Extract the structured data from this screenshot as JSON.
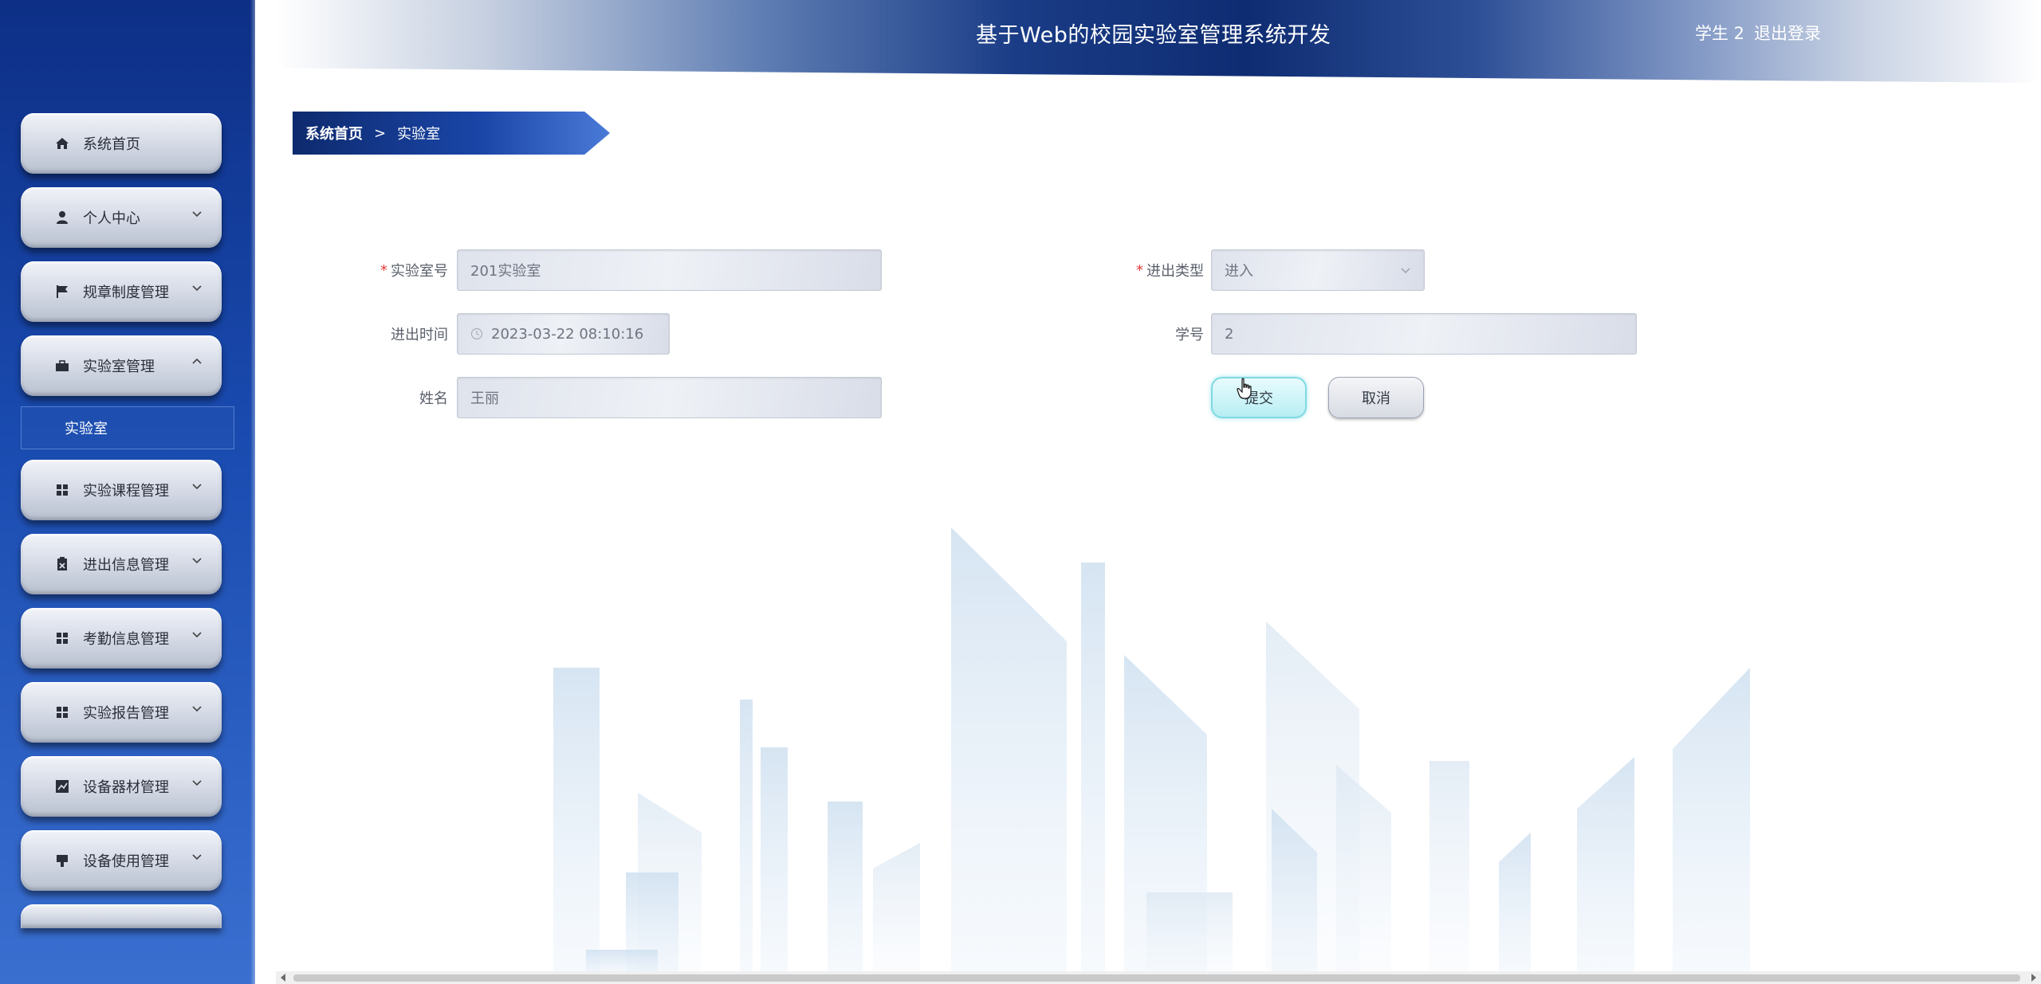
{
  "header": {
    "title": "基于Web的校园实验室管理系统开发",
    "user": "学生 2",
    "logout": "退出登录"
  },
  "breadcrumb": {
    "home": "系统首页",
    "separator": ">",
    "current": "实验室"
  },
  "sidebar": {
    "items": [
      {
        "label": "系统首页",
        "icon": "home-icon"
      },
      {
        "label": "个人中心",
        "icon": "user-icon"
      },
      {
        "label": "规章制度管理",
        "icon": "flag-icon"
      },
      {
        "label": "实验室管理",
        "icon": "briefcase-icon"
      },
      {
        "label": "实验课程管理",
        "icon": "grid-icon"
      },
      {
        "label": "进出信息管理",
        "icon": "clipboard-icon"
      },
      {
        "label": "考勤信息管理",
        "icon": "grid-icon"
      },
      {
        "label": "实验报告管理",
        "icon": "grid-icon"
      },
      {
        "label": "设备器材管理",
        "icon": "chart-icon"
      },
      {
        "label": "设备使用管理",
        "icon": "device-icon"
      }
    ],
    "submenu": {
      "label": "实验室"
    }
  },
  "form": {
    "lab_no": {
      "label": "实验室号",
      "value": "201实验室"
    },
    "direction": {
      "label": "进出类型",
      "value": "进入"
    },
    "time": {
      "label": "进出时间",
      "value": "2023-03-22 08:10:16"
    },
    "student_no": {
      "label": "学号",
      "value": "2"
    },
    "name": {
      "label": "姓名",
      "value": "王丽"
    },
    "submit": "提交",
    "cancel": "取消"
  },
  "colors": {
    "sidebar_dark": "#0d2f86",
    "accent": "#1a46a8",
    "required": "#e23a3a",
    "submit_border": "#7fd9e3"
  }
}
